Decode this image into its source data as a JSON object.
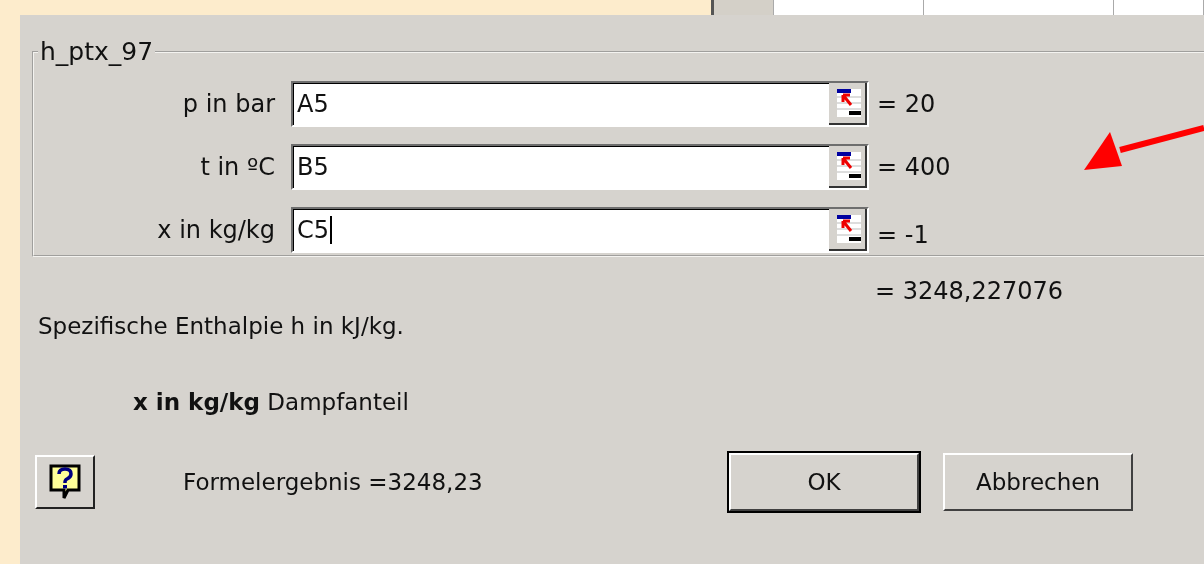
{
  "dialog": {
    "function_name": "h_ptx_97",
    "arguments": [
      {
        "label": "p in bar",
        "value": "A5",
        "result": "= 20",
        "focused": false
      },
      {
        "label": "t in ºC",
        "value": "B5",
        "result": "= 400",
        "focused": false
      },
      {
        "label": "x in kg/kg",
        "value": "C5",
        "result": "= -1",
        "focused": true
      }
    ],
    "result": "= 3248,227076",
    "description": "Spezifische Enthalpie h in kJ/kg.",
    "argument_help": "**x in kg/kg** Dampfanteil",
    "formula_result": "Formelergebnis =3248,23",
    "buttons": [
      {
        "label": "OK",
        "default": true
      },
      {
        "label": "Abbrechen",
        "default": false
      }
    ]
  }
}
